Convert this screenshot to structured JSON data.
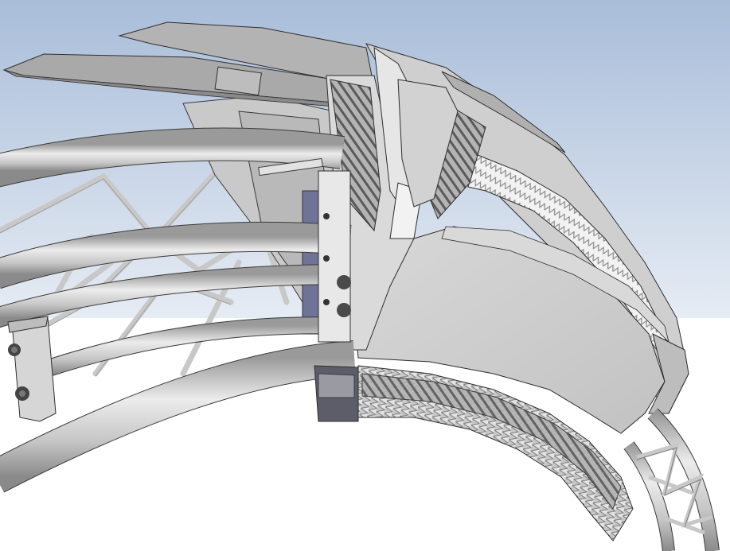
{
  "scene": {
    "kind": "3D CAD render of a curved truss arch with mounted wedge panels",
    "colors": {
      "sky_top": "#a9bdd9",
      "sky_bottom": "#e6ecf4",
      "ground": "#ffffff",
      "tube_light": "#e8e8e8",
      "tube_mid": "#bdbdbd",
      "tube_dark": "#8e8e8e",
      "panel_light": "#e2e2e2",
      "panel_mid": "#cfcfcf",
      "panel_dark": "#a8a8a8",
      "edge": "#3a3a3a",
      "accent_blue": "#6f7396"
    }
  }
}
